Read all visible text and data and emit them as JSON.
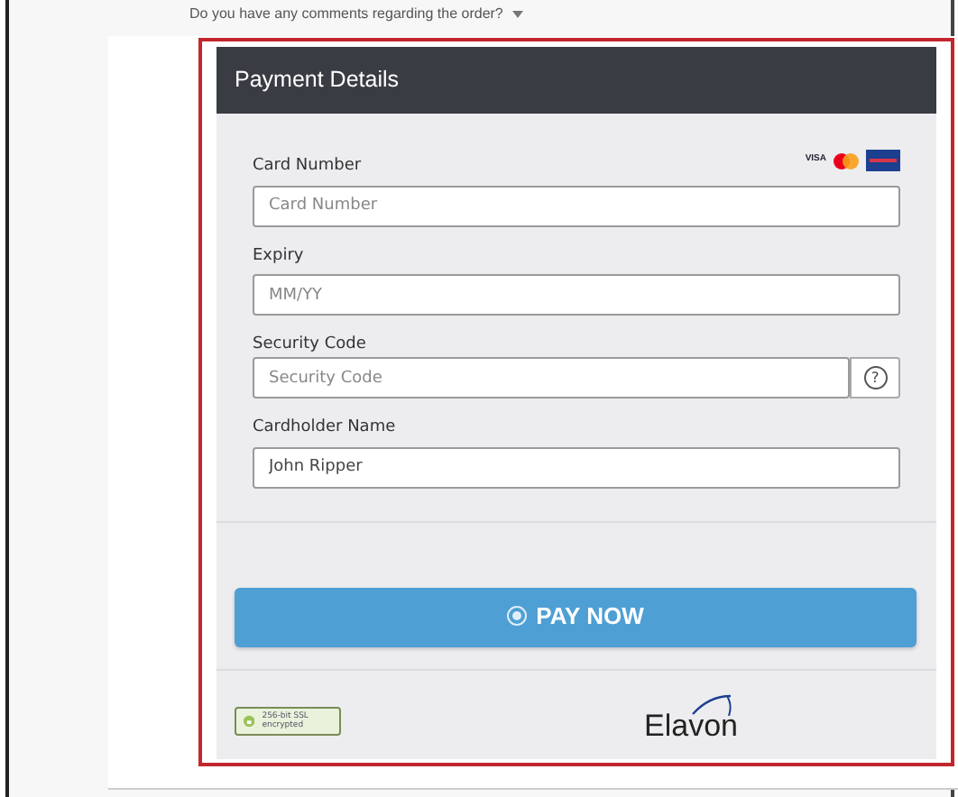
{
  "comments_toggle": {
    "label": "Do you have any comments regarding the order?",
    "expanded": false
  },
  "payment": {
    "title": "Payment Details",
    "card_logos": [
      {
        "kind": "visa",
        "text": "VISA"
      },
      {
        "kind": "mastercard"
      },
      {
        "kind": "maestro"
      }
    ],
    "fields": [
      {
        "label": "Card Number",
        "placeholder": "Card Number"
      },
      {
        "label": "Expiry",
        "placeholder": "MM/YY"
      },
      {
        "label": "Security Code",
        "placeholder": "Security Code",
        "help": "?"
      },
      {
        "label": "Cardholder Name",
        "value": "John Ripper"
      }
    ],
    "pay_button": "PAY NOW",
    "ssl_badge": "256-bit SSL encrypted",
    "provider": "Elavon"
  }
}
